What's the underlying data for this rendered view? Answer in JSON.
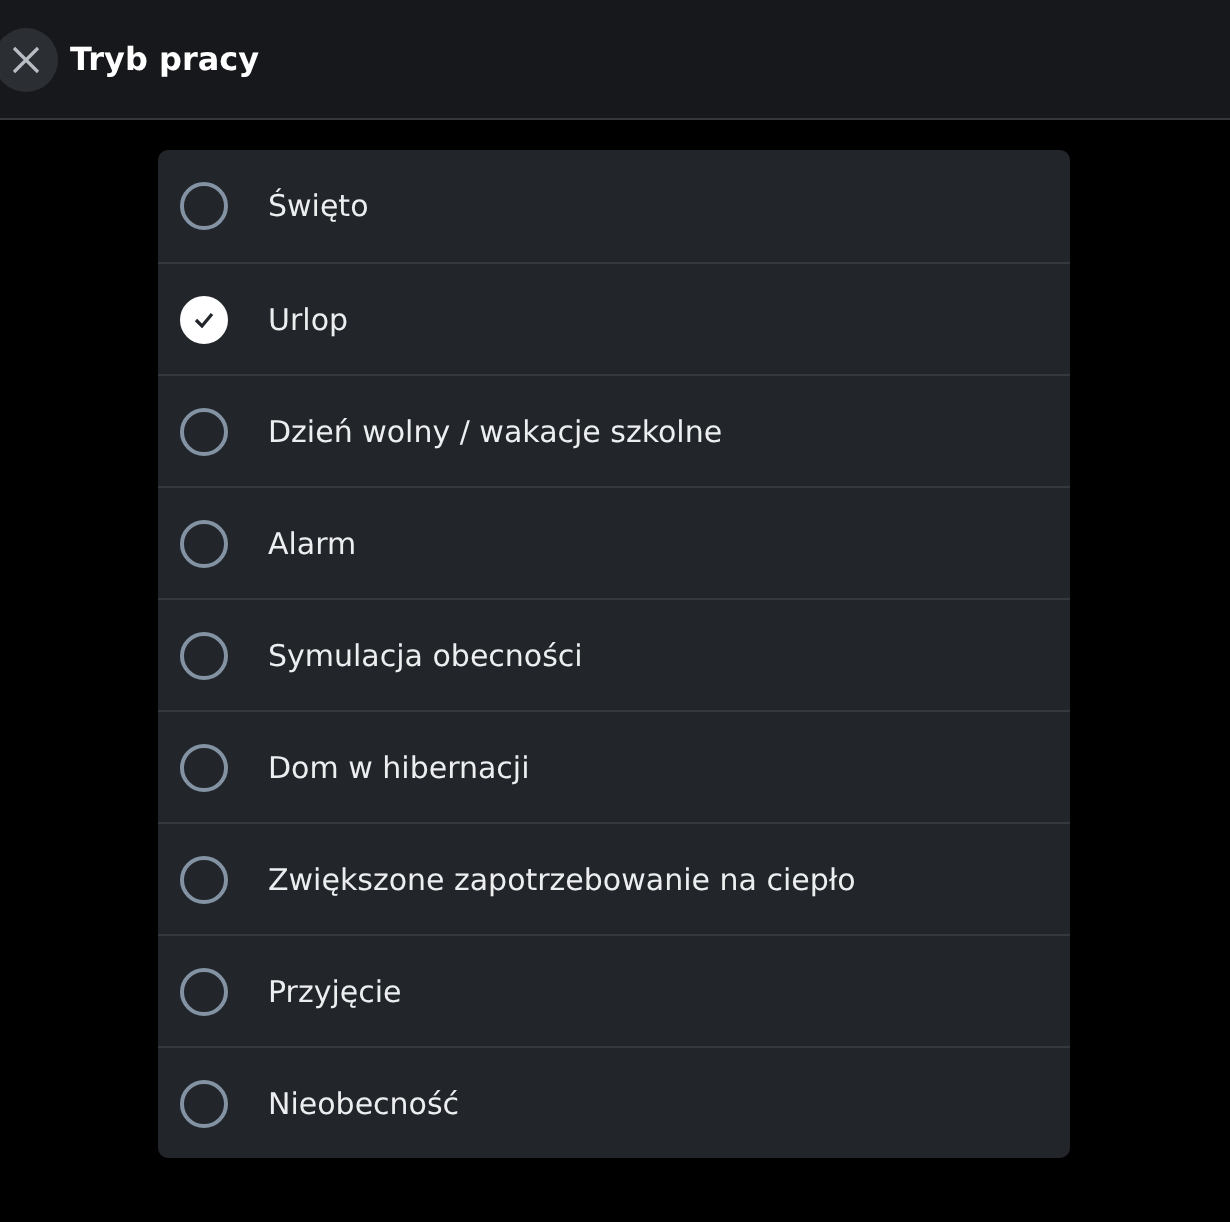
{
  "header": {
    "title": "Tryb pracy"
  },
  "options": [
    {
      "label": "Święto",
      "selected": false
    },
    {
      "label": "Urlop",
      "selected": true
    },
    {
      "label": "Dzień wolny / wakacje szkolne",
      "selected": false
    },
    {
      "label": "Alarm",
      "selected": false
    },
    {
      "label": "Symulacja obecności",
      "selected": false
    },
    {
      "label": "Dom w hibernacji",
      "selected": false
    },
    {
      "label": "Zwiększone zapotrzebowanie na ciepło",
      "selected": false
    },
    {
      "label": "Przyjęcie",
      "selected": false
    },
    {
      "label": "Nieobecność",
      "selected": false
    }
  ]
}
